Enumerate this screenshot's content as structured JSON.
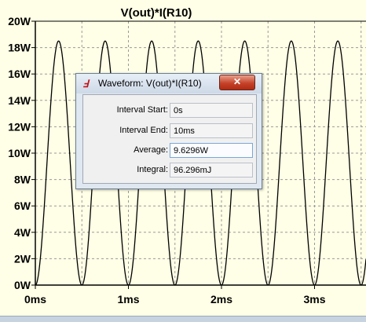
{
  "plot": {
    "title": "V(out)*I(R10)",
    "y_ticks": [
      "20W",
      "18W",
      "16W",
      "14W",
      "12W",
      "10W",
      "8W",
      "6W",
      "4W",
      "2W",
      "0W"
    ],
    "x_ticks": [
      "0ms",
      "1ms",
      "2ms",
      "3ms"
    ],
    "colors": {
      "background": "#fffee6",
      "trace": "#000000",
      "grid": "#9a9a9a"
    }
  },
  "chart_data": {
    "type": "line",
    "title": "V(out)*I(R10)",
    "xlabel": "",
    "ylabel": "",
    "x_unit": "ms",
    "y_unit": "W",
    "xlim": [
      0,
      3.5
    ],
    "ylim": [
      0,
      20
    ],
    "grid": true,
    "series": [
      {
        "peaks_ms": [
          0.25,
          0.75,
          1.25,
          1.75,
          2.25,
          2.75,
          3.25
        ],
        "peak_value_W": 18.5,
        "min_value_W": 0
      }
    ]
  },
  "dialog": {
    "title": "Waveform: V(out)*I(R10)",
    "app_icon": "ltspice-logo-icon",
    "close_label": "✕",
    "fields": [
      {
        "label": "Interval Start:",
        "value": "0s"
      },
      {
        "label": "Interval End:",
        "value": "10ms"
      },
      {
        "label": "Average:",
        "value": "9.6296W"
      },
      {
        "label": "Integral:",
        "value": "96.296mJ"
      }
    ]
  }
}
